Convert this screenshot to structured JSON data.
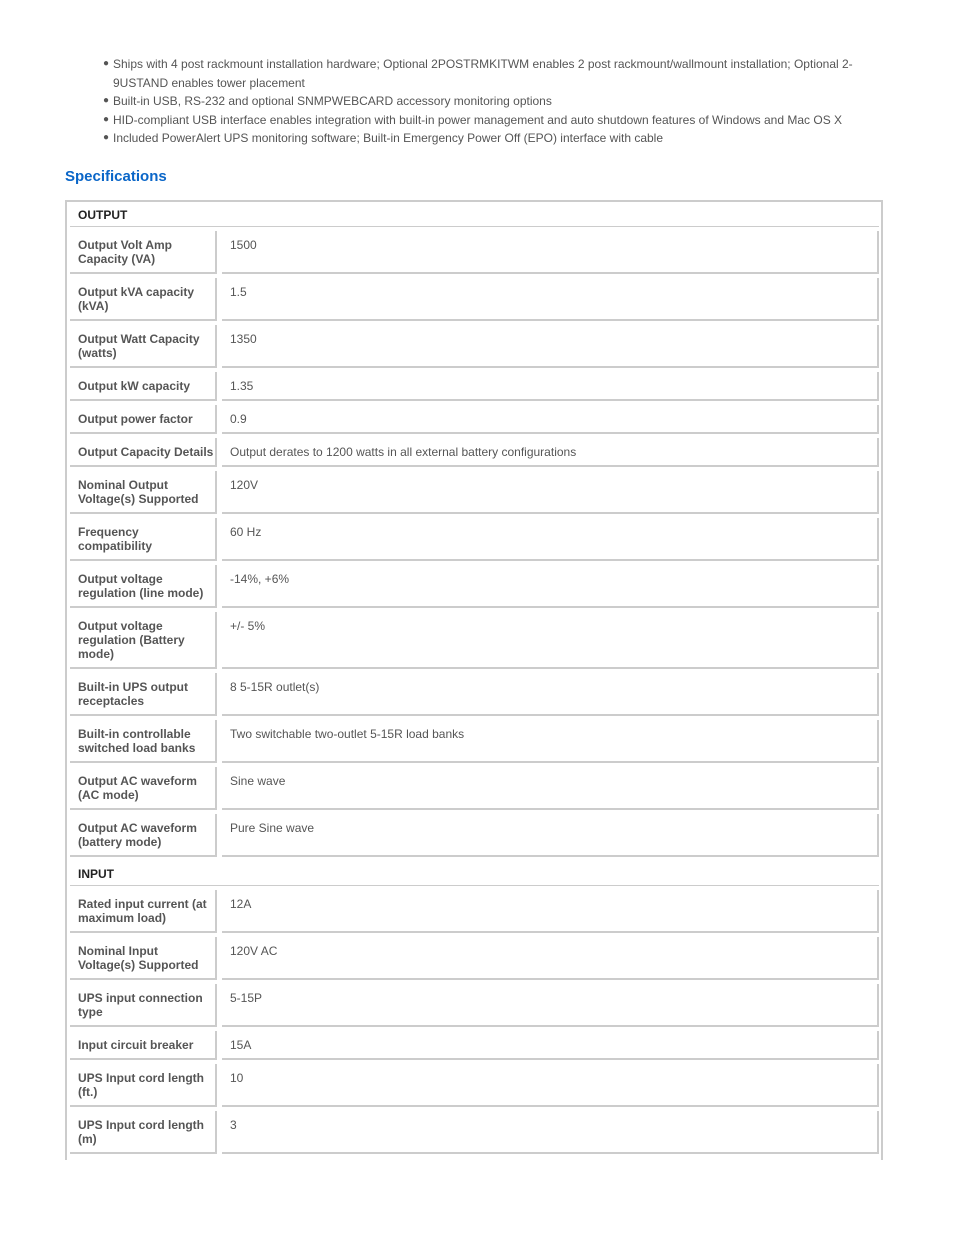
{
  "features": [
    "Ships with 4 post rackmount installation hardware; Optional 2POSTRMKITWM enables 2 post rackmount/wallmount installation; Optional 2-9USTAND enables tower placement",
    "Built-in USB, RS-232 and optional SNMPWEBCARD accessory monitoring options",
    "HID-compliant USB interface enables integration with built-in power management and auto shutdown features of Windows and Mac OS X",
    "Included PowerAlert UPS monitoring software; Built-in Emergency Power Off (EPO) interface with cable"
  ],
  "title": "Specifications",
  "sections": [
    {
      "name": "OUTPUT",
      "rows": [
        [
          "Output Volt Amp Capacity (VA)",
          "1500"
        ],
        [
          "Output kVA capacity (kVA)",
          "1.5"
        ],
        [
          "Output Watt Capacity (watts)",
          "1350"
        ],
        [
          "Output kW capacity",
          "1.35"
        ],
        [
          "Output power factor",
          "0.9"
        ],
        [
          "Output Capacity Details",
          "Output derates to 1200 watts in all external battery configurations"
        ],
        [
          "Nominal Output Voltage(s) Supported",
          "120V"
        ],
        [
          "Frequency compatibility",
          "60 Hz"
        ],
        [
          "Output voltage regulation (line mode)",
          "-14%, +6%"
        ],
        [
          "Output voltage regulation (Battery mode)",
          "+/- 5%"
        ],
        [
          "Built-in UPS output receptacles",
          "8 5-15R outlet(s)"
        ],
        [
          "Built-in controllable switched load banks",
          "Two switchable two-outlet 5-15R load banks"
        ],
        [
          "Output AC waveform (AC mode)",
          "Sine wave"
        ],
        [
          "Output AC waveform (battery mode)",
          "Pure Sine wave"
        ]
      ]
    },
    {
      "name": "INPUT",
      "rows": [
        [
          "Rated input current (at maximum load)",
          "12A"
        ],
        [
          "Nominal Input Voltage(s) Supported",
          "120V AC"
        ],
        [
          "UPS input connection type",
          "5-15P"
        ],
        [
          "Input circuit breaker",
          "15A"
        ],
        [
          "UPS Input cord length (ft.)",
          "10"
        ],
        [
          "UPS Input cord length (m)",
          "3"
        ]
      ]
    }
  ],
  "colors": {
    "title": "#0a66c8",
    "border": "#cccccc",
    "text": "#555555"
  }
}
